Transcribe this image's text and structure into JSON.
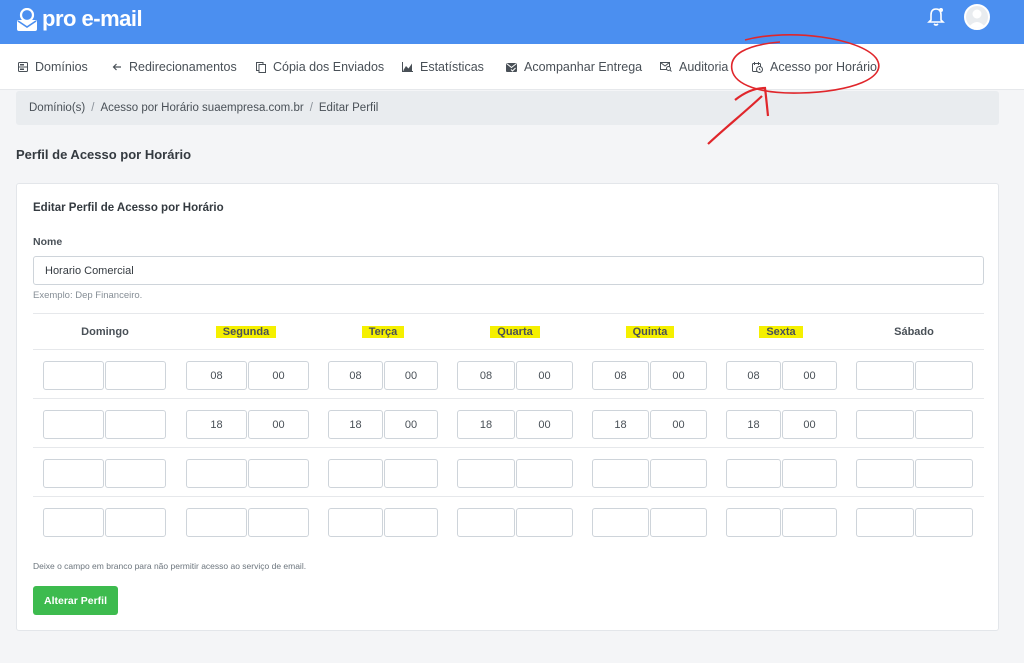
{
  "header": {
    "logo_text": "pro e-mail"
  },
  "nav": {
    "items": [
      {
        "label": "Domínios",
        "icon": "server-icon"
      },
      {
        "label": "Redirecionamentos",
        "icon": "arrow-left-icon"
      },
      {
        "label": "Cópia dos Enviados",
        "icon": "copy-icon"
      },
      {
        "label": "Estatísticas",
        "icon": "chart-icon"
      },
      {
        "label": "Acompanhar Entrega",
        "icon": "mail-check-icon"
      },
      {
        "label": "Auditoria",
        "icon": "mail-search-icon"
      },
      {
        "label": "Acesso por Horário",
        "icon": "calendar-clock-icon"
      }
    ]
  },
  "breadcrumb": [
    "Domínio(s)",
    "Acesso por Horário suaempresa.com.br",
    "Editar Perfil"
  ],
  "page_title": "Perfil de Acesso por Horário",
  "card": {
    "title": "Editar Perfil de Acesso por Horário",
    "name_label": "Nome",
    "name_value": "Horario Comercial",
    "name_help": "Exemplo: Dep Financeiro.",
    "days": [
      "Domingo",
      "Segunda",
      "Terça",
      "Quarta",
      "Quinta",
      "Sexta",
      "Sábado"
    ],
    "highlighted_days": [
      "Segunda",
      "Terça",
      "Quarta",
      "Quinta",
      "Sexta"
    ],
    "schedule": [
      [
        [
          "",
          ""
        ],
        [
          "08",
          "00"
        ],
        [
          "08",
          "00"
        ],
        [
          "08",
          "00"
        ],
        [
          "08",
          "00"
        ],
        [
          "08",
          "00"
        ],
        [
          "",
          ""
        ]
      ],
      [
        [
          "",
          ""
        ],
        [
          "18",
          "00"
        ],
        [
          "18",
          "00"
        ],
        [
          "18",
          "00"
        ],
        [
          "18",
          "00"
        ],
        [
          "18",
          "00"
        ],
        [
          "",
          ""
        ]
      ],
      [
        [
          "",
          ""
        ],
        [
          "",
          ""
        ],
        [
          "",
          ""
        ],
        [
          "",
          ""
        ],
        [
          "",
          ""
        ],
        [
          "",
          ""
        ],
        [
          "",
          ""
        ]
      ],
      [
        [
          "",
          ""
        ],
        [
          "",
          ""
        ],
        [
          "",
          ""
        ],
        [
          "",
          ""
        ],
        [
          "",
          ""
        ],
        [
          "",
          ""
        ],
        [
          "",
          ""
        ]
      ]
    ],
    "footnote": "Deixe o campo em branco para não permitir acesso ao serviço de email.",
    "submit_label": "Alterar Perfil"
  },
  "colors": {
    "topbar": "#4b8ff0",
    "button": "#3dbb4e",
    "highlight": "#f5f000",
    "annotation": "#e0262b"
  }
}
